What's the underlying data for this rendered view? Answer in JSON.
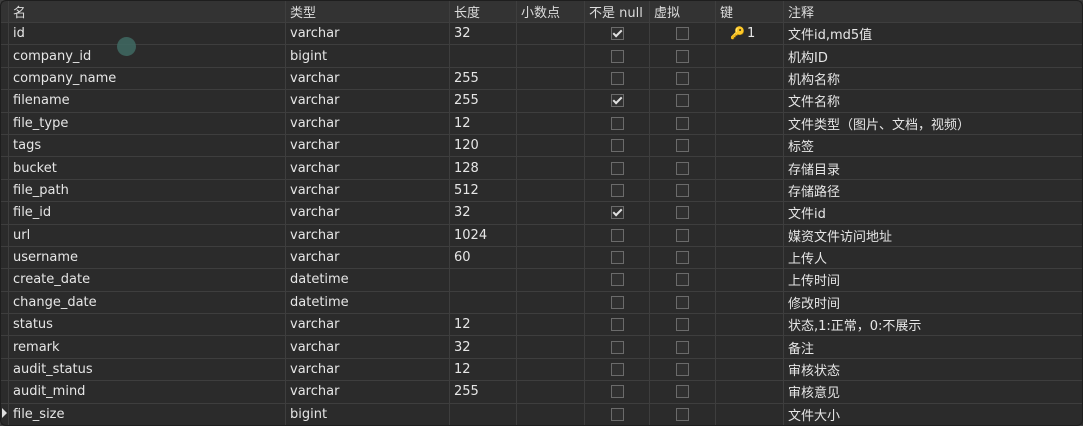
{
  "headers": [
    "名",
    "类型",
    "长度",
    "小数点",
    "不是 null",
    "虚拟",
    "键",
    "注释"
  ],
  "rows": [
    {
      "name": "id",
      "type": "varchar",
      "length": "32",
      "decimal": "",
      "not_null": true,
      "virtual": false,
      "key": "1",
      "comment": "文件id,md5值"
    },
    {
      "name": "company_id",
      "type": "bigint",
      "length": "",
      "decimal": "",
      "not_null": false,
      "virtual": false,
      "key": "",
      "comment": "机构ID"
    },
    {
      "name": "company_name",
      "type": "varchar",
      "length": "255",
      "decimal": "",
      "not_null": false,
      "virtual": false,
      "key": "",
      "comment": "机构名称"
    },
    {
      "name": "filename",
      "type": "varchar",
      "length": "255",
      "decimal": "",
      "not_null": true,
      "virtual": false,
      "key": "",
      "comment": "文件名称"
    },
    {
      "name": "file_type",
      "type": "varchar",
      "length": "12",
      "decimal": "",
      "not_null": false,
      "virtual": false,
      "key": "",
      "comment": "文件类型（图片、文档，视频）"
    },
    {
      "name": "tags",
      "type": "varchar",
      "length": "120",
      "decimal": "",
      "not_null": false,
      "virtual": false,
      "key": "",
      "comment": "标签"
    },
    {
      "name": "bucket",
      "type": "varchar",
      "length": "128",
      "decimal": "",
      "not_null": false,
      "virtual": false,
      "key": "",
      "comment": "存储目录"
    },
    {
      "name": "file_path",
      "type": "varchar",
      "length": "512",
      "decimal": "",
      "not_null": false,
      "virtual": false,
      "key": "",
      "comment": "存储路径"
    },
    {
      "name": "file_id",
      "type": "varchar",
      "length": "32",
      "decimal": "",
      "not_null": true,
      "virtual": false,
      "key": "",
      "comment": "文件id"
    },
    {
      "name": "url",
      "type": "varchar",
      "length": "1024",
      "decimal": "",
      "not_null": false,
      "virtual": false,
      "key": "",
      "comment": "媒资文件访问地址"
    },
    {
      "name": "username",
      "type": "varchar",
      "length": "60",
      "decimal": "",
      "not_null": false,
      "virtual": false,
      "key": "",
      "comment": "上传人"
    },
    {
      "name": "create_date",
      "type": "datetime",
      "length": "",
      "decimal": "",
      "not_null": false,
      "virtual": false,
      "key": "",
      "comment": "上传时间"
    },
    {
      "name": "change_date",
      "type": "datetime",
      "length": "",
      "decimal": "",
      "not_null": false,
      "virtual": false,
      "key": "",
      "comment": "修改时间"
    },
    {
      "name": "status",
      "type": "varchar",
      "length": "12",
      "decimal": "",
      "not_null": false,
      "virtual": false,
      "key": "",
      "comment": "状态,1:正常，0:不展示"
    },
    {
      "name": "remark",
      "type": "varchar",
      "length": "32",
      "decimal": "",
      "not_null": false,
      "virtual": false,
      "key": "",
      "comment": "备注"
    },
    {
      "name": "audit_status",
      "type": "varchar",
      "length": "12",
      "decimal": "",
      "not_null": false,
      "virtual": false,
      "key": "",
      "comment": "审核状态"
    },
    {
      "name": "audit_mind",
      "type": "varchar",
      "length": "255",
      "decimal": "",
      "not_null": false,
      "virtual": false,
      "key": "",
      "comment": "审核意见"
    },
    {
      "name": "file_size",
      "type": "bigint",
      "length": "",
      "decimal": "",
      "not_null": false,
      "virtual": false,
      "key": "",
      "comment": "文件大小"
    }
  ],
  "selected_row": 17,
  "icons": {
    "key": "key-icon",
    "row_pointer": "triangle-right-icon"
  },
  "colors": {
    "background": "#2b2b2b",
    "header": "#333333",
    "key": "#f0b020",
    "grid": "#3e3e3e"
  }
}
